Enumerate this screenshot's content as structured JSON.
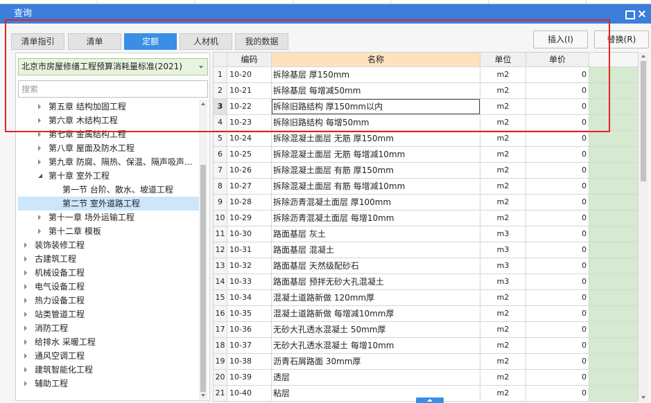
{
  "window": {
    "title": "查询",
    "icons": {
      "maximize": "maximize-icon",
      "close": "close-icon",
      "dropdown": "chevron-down-icon",
      "tree_toggle": "tree-toggle-icon"
    }
  },
  "colors": {
    "title_bar": "#3c7edc",
    "active_tab": "#3a8ee6",
    "annotation_box": "#e3231f",
    "tree_selected": "#cce6fb",
    "name_header": "#fde2be",
    "extra_column": "#d5ead1",
    "standard_select_bg": "#e8f3e0"
  },
  "tabs": [
    {
      "label": "清单指引",
      "active": false
    },
    {
      "label": "清单",
      "active": false
    },
    {
      "label": "定额",
      "active": true
    },
    {
      "label": "人材机",
      "active": false
    },
    {
      "label": "我的数据",
      "active": false
    }
  ],
  "actions": {
    "insert_label": "插入(I)",
    "replace_label": "替换(R)"
  },
  "left_panel": {
    "standard_select": {
      "value": "北京市房屋修缮工程预算消耗量标准(2021)"
    },
    "search": {
      "placeholder": "搜索",
      "value": ""
    },
    "tree": [
      {
        "label": "第五章 结构加固工程",
        "level": 2,
        "expandable": true,
        "expanded": false,
        "selected": false
      },
      {
        "label": "第六章 木结构工程",
        "level": 2,
        "expandable": true,
        "expanded": false,
        "selected": false
      },
      {
        "label": "第七章 金属结构工程",
        "level": 2,
        "expandable": true,
        "expanded": false,
        "selected": false
      },
      {
        "label": "第八章 屋面及防水工程",
        "level": 2,
        "expandable": true,
        "expanded": false,
        "selected": false
      },
      {
        "label": "第九章 防腐、隔热、保温、隔声吸声…",
        "level": 2,
        "expandable": true,
        "expanded": false,
        "selected": false
      },
      {
        "label": "第十章 室外工程",
        "level": 2,
        "expandable": true,
        "expanded": true,
        "selected": false
      },
      {
        "label": "第一节 台阶、散水、坡道工程",
        "level": 3,
        "expandable": false,
        "expanded": false,
        "selected": false
      },
      {
        "label": "第二节 室外道路工程",
        "level": 3,
        "expandable": false,
        "expanded": false,
        "selected": true
      },
      {
        "label": "第十一章 场外运输工程",
        "level": 2,
        "expandable": true,
        "expanded": false,
        "selected": false
      },
      {
        "label": "第十二章 模板",
        "level": 2,
        "expandable": true,
        "expanded": false,
        "selected": false
      },
      {
        "label": "装饰装修工程",
        "level": 1,
        "expandable": true,
        "expanded": false,
        "selected": false
      },
      {
        "label": "古建筑工程",
        "level": 1,
        "expandable": true,
        "expanded": false,
        "selected": false
      },
      {
        "label": "机械设备工程",
        "level": 1,
        "expandable": true,
        "expanded": false,
        "selected": false
      },
      {
        "label": "电气设备工程",
        "level": 1,
        "expandable": true,
        "expanded": false,
        "selected": false
      },
      {
        "label": "热力设备工程",
        "level": 1,
        "expandable": true,
        "expanded": false,
        "selected": false
      },
      {
        "label": "站类管道工程",
        "level": 1,
        "expandable": true,
        "expanded": false,
        "selected": false
      },
      {
        "label": "消防工程",
        "level": 1,
        "expandable": true,
        "expanded": false,
        "selected": false
      },
      {
        "label": "给排水 采暖工程",
        "level": 1,
        "expandable": true,
        "expanded": false,
        "selected": false
      },
      {
        "label": "通风空调工程",
        "level": 1,
        "expandable": true,
        "expanded": false,
        "selected": false
      },
      {
        "label": "建筑智能化工程",
        "level": 1,
        "expandable": true,
        "expanded": false,
        "selected": false
      },
      {
        "label": "辅助工程",
        "level": 1,
        "expandable": true,
        "expanded": false,
        "selected": false
      }
    ]
  },
  "table": {
    "headers": {
      "code": "编码",
      "name": "名称",
      "unit": "单位",
      "price": "单价"
    },
    "rows": [
      {
        "no": "1",
        "code": "10-20",
        "name": "拆除基层 厚150mm",
        "unit": "m2",
        "price": "0",
        "selected": false
      },
      {
        "no": "2",
        "code": "10-21",
        "name": "拆除基层 每增减50mm",
        "unit": "m2",
        "price": "0",
        "selected": false
      },
      {
        "no": "3",
        "code": "10-22",
        "name": "拆除旧路结构 厚150mm以内",
        "unit": "m2",
        "price": "0",
        "selected": true
      },
      {
        "no": "4",
        "code": "10-23",
        "name": "拆除旧路结构 每增50mm",
        "unit": "m2",
        "price": "0",
        "selected": false
      },
      {
        "no": "5",
        "code": "10-24",
        "name": "拆除混凝土面层 无筋 厚150mm",
        "unit": "m2",
        "price": "0",
        "selected": false
      },
      {
        "no": "6",
        "code": "10-25",
        "name": "拆除混凝土面层 无筋 每增减10mm",
        "unit": "m2",
        "price": "0",
        "selected": false
      },
      {
        "no": "7",
        "code": "10-26",
        "name": "拆除混凝土面层 有筋 厚150mm",
        "unit": "m2",
        "price": "0",
        "selected": false
      },
      {
        "no": "8",
        "code": "10-27",
        "name": "拆除混凝土面层 有筋 每增减10mm",
        "unit": "m2",
        "price": "0",
        "selected": false
      },
      {
        "no": "9",
        "code": "10-28",
        "name": "拆除沥青混凝土面层 厚100mm",
        "unit": "m2",
        "price": "0",
        "selected": false
      },
      {
        "no": "10",
        "code": "10-29",
        "name": "拆除沥青混凝土面层 每增10mm",
        "unit": "m2",
        "price": "0",
        "selected": false
      },
      {
        "no": "11",
        "code": "10-30",
        "name": "路面基层 灰土",
        "unit": "m3",
        "price": "0",
        "selected": false
      },
      {
        "no": "12",
        "code": "10-31",
        "name": "路面基层 混凝土",
        "unit": "m3",
        "price": "0",
        "selected": false
      },
      {
        "no": "13",
        "code": "10-32",
        "name": "路面基层 天然级配砂石",
        "unit": "m3",
        "price": "0",
        "selected": false
      },
      {
        "no": "14",
        "code": "10-33",
        "name": "路面基层 预拌无砂大孔混凝土",
        "unit": "m3",
        "price": "0",
        "selected": false
      },
      {
        "no": "15",
        "code": "10-34",
        "name": "混凝土道路新做 120mm厚",
        "unit": "m2",
        "price": "0",
        "selected": false
      },
      {
        "no": "16",
        "code": "10-35",
        "name": "混凝土道路新做 每增减10mm厚",
        "unit": "m2",
        "price": "0",
        "selected": false
      },
      {
        "no": "17",
        "code": "10-36",
        "name": "无砂大孔透水混凝土 50mm厚",
        "unit": "m2",
        "price": "0",
        "selected": false
      },
      {
        "no": "18",
        "code": "10-37",
        "name": "无砂大孔透水混凝土 每增10mm",
        "unit": "m2",
        "price": "0",
        "selected": false
      },
      {
        "no": "19",
        "code": "10-38",
        "name": "沥青石屑路面 30mm厚",
        "unit": "m2",
        "price": "0",
        "selected": false
      },
      {
        "no": "20",
        "code": "10-39",
        "name": "透层",
        "unit": "m2",
        "price": "0",
        "selected": false
      },
      {
        "no": "21",
        "code": "10-40",
        "name": "粘层",
        "unit": "m2",
        "price": "0",
        "selected": false
      }
    ]
  }
}
